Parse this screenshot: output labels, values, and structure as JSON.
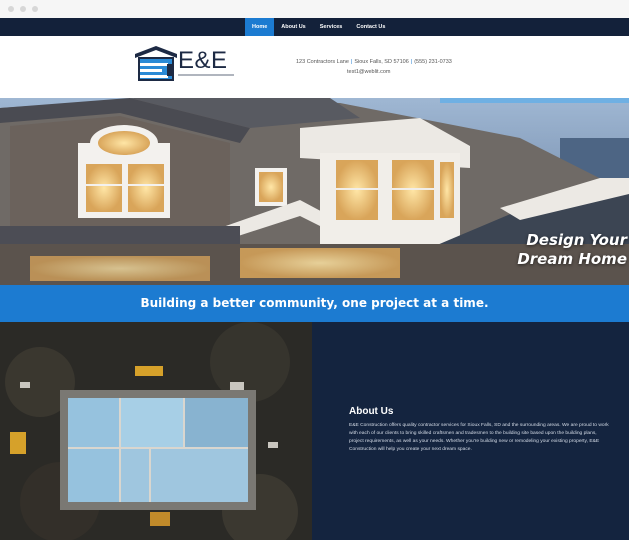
{
  "nav": {
    "items": [
      {
        "label": "Home",
        "active": true
      },
      {
        "label": "About Us",
        "active": false
      },
      {
        "label": "Services",
        "active": false
      },
      {
        "label": "Contact Us",
        "active": false
      }
    ]
  },
  "header": {
    "logo_text": "E&E",
    "address": "123 Contractors Lane",
    "city": "Sioux Falls, SD 57106",
    "phone": "(555) 231-0733",
    "email": "test1@weblit.com"
  },
  "hero": {
    "tagline_line1": "Design Your",
    "tagline_line2": "Dream Home"
  },
  "banner": {
    "text": "Building a better community, one project at a time."
  },
  "about": {
    "title": "About Us",
    "body": "E&E Construction offers quality contractor services for Sioux Falls, SD and the surrounding areas. We are proud to work with each of our clients to bring skilled craftsmen and tradesmen to the building site based upon the building plans, project requirements, as well as your needs. Whether you're building new or remodeling your existing property, E&E Construction will help you create your next dream space."
  },
  "colors": {
    "nav_bg": "#13213a",
    "accent": "#1c7bd1",
    "dark_section": "#14243f"
  }
}
